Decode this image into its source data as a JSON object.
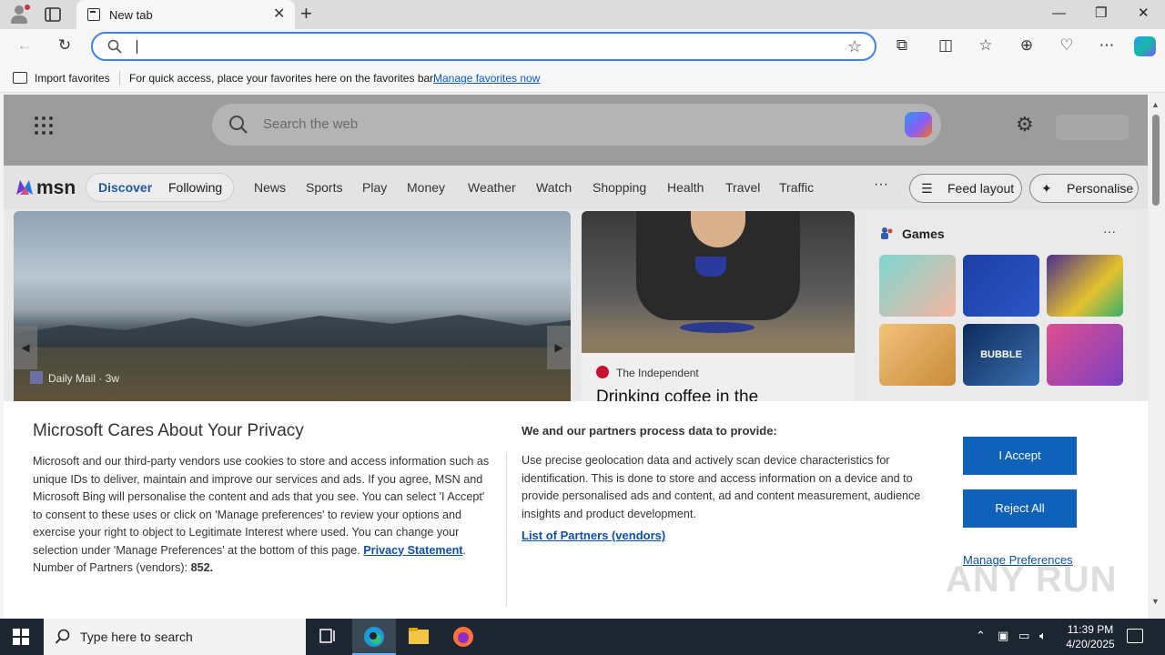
{
  "browser": {
    "tab_title": "New tab",
    "address_value": "",
    "favorites_bar": {
      "import_label": "Import favorites",
      "message": "For quick access, place your favorites here on the favorites bar.",
      "manage_link": "Manage favorites now"
    }
  },
  "msn": {
    "search_placeholder": "Search the web",
    "logo_text": "msn",
    "feed_tabs": [
      "Discover",
      "Following"
    ],
    "categories": [
      "News",
      "Sports",
      "Play",
      "Money",
      "Weather",
      "Watch",
      "Shopping",
      "Health",
      "Travel",
      "Traffic"
    ],
    "more_label": "···",
    "feed_layout_label": "Feed layout",
    "personalise_label": "Personalise",
    "main_card": {
      "source": "Daily Mail",
      "age": "3w"
    },
    "side_card": {
      "source": "The Independent",
      "headline": "Drinking coffee in the"
    },
    "games": {
      "title": "Games",
      "more": "···",
      "tile4_label": "BUBBLE SHOOTER"
    }
  },
  "privacy": {
    "title": "Microsoft Cares About Your Privacy",
    "body": "Microsoft and our third-party vendors use cookies to store and access information such as unique IDs to deliver, maintain and improve our services and ads. If you agree, MSN and Microsoft Bing will personalise the content and ads that you see. You can select 'I Accept' to consent to these uses or click on 'Manage preferences' to review your options and exercise your right to object to Legitimate Interest where used.  You can change your selection under 'Manage Preferences' at the bottom of this page.",
    "privacy_link": "Privacy Statement",
    "partners_label": "Number of Partners (vendors):",
    "partners_count": "852.",
    "subtitle": "We and our partners process data to provide:",
    "purposes": "Use precise geolocation data and actively scan device characteristics for identification. This is done to store and access information on a device and to provide personalised ads and content, ad and content measurement, audience insights and product development.",
    "list_partners_link": "List of Partners (vendors)",
    "accept_label": "I Accept",
    "reject_label": "Reject All",
    "manage_label": "Manage Preferences",
    "watermark": "ANY RUN"
  },
  "taskbar": {
    "search_placeholder": "Type here to search",
    "time": "11:39 PM",
    "date": "4/20/2025"
  }
}
